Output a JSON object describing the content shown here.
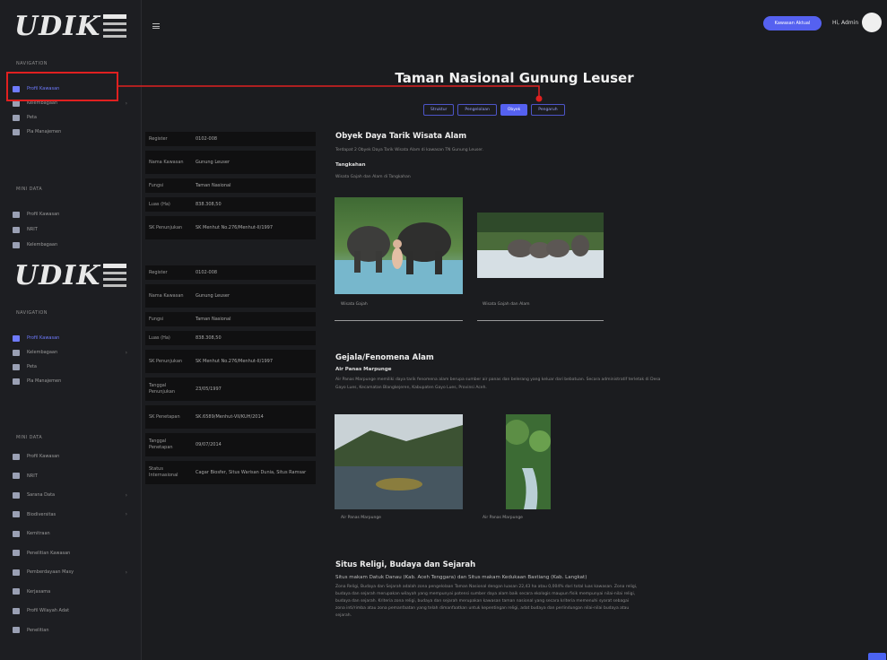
{
  "sidebar": {
    "logo_top": "UDIK",
    "logo_bottom": "UDIK",
    "section1": "NAVIGATION",
    "items1": [
      {
        "label": "Profil Kawasan",
        "active": true,
        "chev": false
      },
      {
        "label": "Kelembagaan",
        "active": false,
        "chev": true
      },
      {
        "label": "Peta",
        "active": false,
        "chev": false
      },
      {
        "label": "Pla Manajemen",
        "active": false,
        "chev": false
      }
    ],
    "section2": "MINI DATA",
    "items2": [
      {
        "label": "Profil Kawasan",
        "chev": false
      },
      {
        "label": "NRIT",
        "chev": false
      },
      {
        "label": "Kelembagaan",
        "chev": false
      }
    ],
    "section3": "NAVIGATION",
    "items3": [
      {
        "label": "Profil Kawasan",
        "active": true,
        "chev": false
      },
      {
        "label": "Kelembagaan",
        "active": false,
        "chev": true
      },
      {
        "label": "Peta",
        "active": false,
        "chev": false
      },
      {
        "label": "Pla Manajemen",
        "active": false,
        "chev": false
      }
    ],
    "section4": "MINI DATA",
    "items4": [
      {
        "label": "Profil Kawasan",
        "chev": false
      },
      {
        "label": "NRIT",
        "chev": false
      },
      {
        "label": "Sarana Data",
        "chev": true
      },
      {
        "label": "Biodiversitas",
        "chev": true
      },
      {
        "label": "Kemitraan",
        "chev": false
      },
      {
        "label": "Penelitian Kawasan",
        "chev": false
      },
      {
        "label": "Pemberdayaan Masy",
        "chev": true
      },
      {
        "label": "Kerjasama",
        "chev": false
      },
      {
        "label": "Profil Wilayah Adat",
        "chev": false
      },
      {
        "label": "Penelitian",
        "chev": false
      }
    ]
  },
  "header": {
    "pill_label": "Kawasan Aktual",
    "greeting": "Hi, Admin"
  },
  "main": {
    "title": "Taman Nasional Gunung Leuser",
    "tabs": [
      {
        "label": "Struktur",
        "active": false
      },
      {
        "label": "Pengelolaan",
        "active": false
      },
      {
        "label": "Obyek",
        "active": true
      },
      {
        "label": "Pengaruh",
        "active": false
      }
    ]
  },
  "info_table_1": [
    {
      "k": "Register",
      "v": "0102-008"
    },
    {
      "k": "Nama Kawasan",
      "v": "Gunung Leuser"
    },
    {
      "k": "Fungsi",
      "v": "Taman Nasional"
    },
    {
      "k": "Luas (Ha)",
      "v": "838.308,50"
    },
    {
      "k": "SK Penunjukan",
      "v": "SK Menhut No.276/Menhut-II/1997"
    }
  ],
  "info_table_2": [
    {
      "k": "Register",
      "v": "0102-008"
    },
    {
      "k": "Nama Kawasan",
      "v": "Gunung Leuser"
    },
    {
      "k": "Fungsi",
      "v": "Taman Nasional"
    },
    {
      "k": "Luas (Ha)",
      "v": "838.308,50"
    },
    {
      "k": "SK Penunjukan",
      "v": "SK Menhut No.276/Menhut-II/1997"
    },
    {
      "k": "Tanggal Penunjukan",
      "v": "23/05/1997"
    },
    {
      "k": "SK Penetapan",
      "v": "SK.6589/Menhut-VII/KUH/2014"
    },
    {
      "k": "Tanggal Penetapan",
      "v": "09/07/2014"
    },
    {
      "k": "Status Internasional",
      "v": "Cagar Biosfer, Situs Warisan Dunia, Situs Ramsar"
    }
  ],
  "section_a": {
    "title": "Obyek Daya Tarik Wisata Alam",
    "desc": "Terdapat 2 Obyek Daya Tarik Wisata Alam di kawasan TN Gunung Leuser.",
    "sub": "Tangkahan",
    "sub_desc": "Wisata Gajah dan Alam di Tangkahan",
    "photos": [
      {
        "caption": "Wisata Gajah"
      },
      {
        "caption": "Wisata Gajah dan Alam"
      }
    ]
  },
  "section_b": {
    "title": "Gejala/Fenomena Alam",
    "sub": "Air Panas Marpunge",
    "desc1": "Air Panas Marpunge memiliki daya tarik fenomena alam berupa sumber air panas dan belerang yang keluar dari bebatuan. Secara administratif terletak di Desa",
    "desc2": "Gayo Lues, Kecamatan Blangkejeren, Kabupaten Gayo Lues, Provinsi Aceh.",
    "photos": [
      {
        "caption": "Air Panas Marpunge"
      },
      {
        "caption": "Air Panas Marpunge"
      }
    ]
  },
  "section_c": {
    "title": "Situs Religi, Budaya dan Sejarah",
    "sub": "Situs makam Datuk Danau (Kab. Aceh Tenggara) dan Situs makam Kedukaan Bastiang (Kab. Langkat)",
    "lines": [
      "Zona Religi, Budaya dan Sejarah adalah zona pengelolaan Taman Nasional dengan luasan 22,43 ha atau 0,004% dari total luas kawasan. Zona religi,",
      "budaya dan sejarah merupakan wilayah yang mempunyai potensi sumber daya alam baik secara ekologis maupun fisik mempunyai nilai-nilai religi,",
      "budaya dan sejarah. Kriteria zona religi, budaya dan sejarah merupakan kawasan taman nasional yang secara kriteria memenuhi syarat sebagai",
      "zona inti/rimba atau zona pemanfaatan yang telah dimanfaatkan untuk kepentingan religi, adat budaya dan perlindungan nilai-nilai budaya atau",
      "sejarah."
    ]
  },
  "colors": {
    "accent": "#5561f0",
    "background": "#1b1c1f",
    "sidebar": "#1d1e22",
    "table_cell": "#101011"
  }
}
